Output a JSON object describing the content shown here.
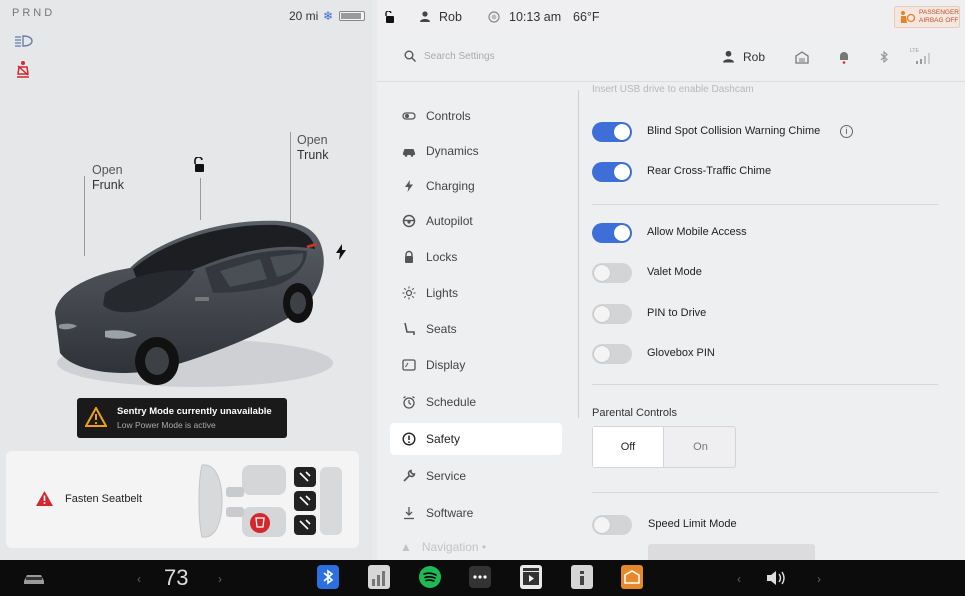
{
  "status": {
    "gear": "PRND",
    "range": "20 mi",
    "user": "Rob",
    "time": "10:13 am",
    "temperature": "66°F",
    "airbag_line1": "PASSENGER",
    "airbag_line2": "AIRBAG OFF"
  },
  "car": {
    "frunk_line1": "Open",
    "frunk_line2": "Frunk",
    "trunk_line1": "Open",
    "trunk_line2": "Trunk",
    "sentry_title": "Sentry Mode currently unavailable",
    "sentry_sub": "Low Power Mode is active",
    "seatbelt_msg": "Fasten Seatbelt"
  },
  "search": {
    "placeholder": "Search Settings"
  },
  "header": {
    "user": "Rob",
    "network": "LTE"
  },
  "nav": [
    {
      "label": "Controls",
      "icon": "toggle-icon"
    },
    {
      "label": "Dynamics",
      "icon": "car-icon"
    },
    {
      "label": "Charging",
      "icon": "bolt-icon"
    },
    {
      "label": "Autopilot",
      "icon": "steering-wheel-icon"
    },
    {
      "label": "Locks",
      "icon": "lock-icon"
    },
    {
      "label": "Lights",
      "icon": "sun-icon"
    },
    {
      "label": "Seats",
      "icon": "seat-icon"
    },
    {
      "label": "Display",
      "icon": "display-icon"
    },
    {
      "label": "Schedule",
      "icon": "alarm-clock-icon"
    },
    {
      "label": "Safety",
      "icon": "alert-circle-icon",
      "active": true
    },
    {
      "label": "Service",
      "icon": "wrench-icon"
    },
    {
      "label": "Software",
      "icon": "download-icon"
    },
    {
      "label": "Navigation",
      "icon": "navigation-icon"
    }
  ],
  "settings": {
    "top_hint": "Insert USB drive to enable Dashcam",
    "toggles": [
      {
        "label": "Blind Spot Collision Warning Chime",
        "on": true
      },
      {
        "label": "Rear Cross-Traffic Chime",
        "on": true
      },
      {
        "label": "Allow Mobile Access",
        "on": true
      },
      {
        "label": "Valet Mode",
        "on": false
      },
      {
        "label": "PIN to Drive",
        "on": false
      },
      {
        "label": "Glovebox PIN",
        "on": false
      }
    ],
    "parental_controls": "Parental Controls",
    "parental_options": [
      "Off",
      "On"
    ],
    "parental_selected": "Off",
    "speed_limit_mode": "Speed Limit Mode",
    "speed_limit_on": false
  },
  "dock": {
    "temperature": "73"
  }
}
